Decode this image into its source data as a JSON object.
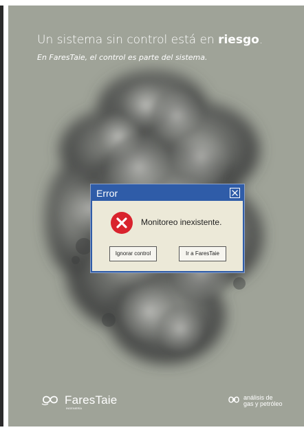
{
  "poster": {
    "headline_lead": "Un sistema sin control está en ",
    "headline_bold": "riesgo",
    "headline_end": ".",
    "subheadline": "En FaresTaie, el control es parte del sistema."
  },
  "dialog": {
    "title": "Error",
    "message": "Monitoreo inexistente.",
    "buttons": {
      "ignore": "Ignorar control",
      "go": "Ir a FaresTaie"
    },
    "icons": {
      "close": "close-icon",
      "error": "error-icon"
    }
  },
  "brands": {
    "left": {
      "name": "FaresTaie",
      "sub": "INGENIERÍA"
    },
    "right": {
      "line1": "análisis de",
      "line2": "gas y petróleo"
    }
  },
  "colors": {
    "background": "#9fa398",
    "dialog_title_bar": "#2f5ca8",
    "dialog_body": "#ece9d8",
    "error_red": "#d9232d",
    "text_white": "#ffffff"
  }
}
